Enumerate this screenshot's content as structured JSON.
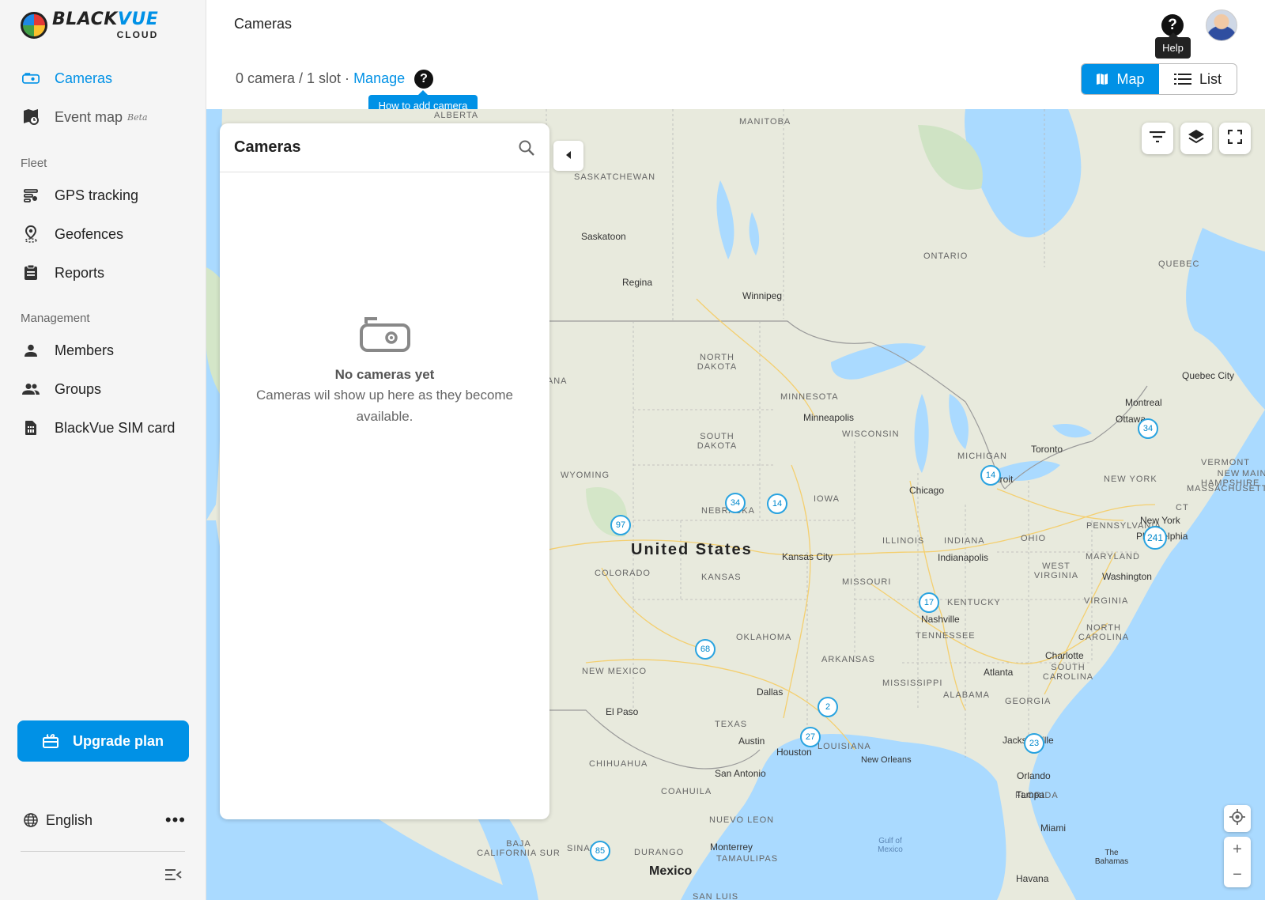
{
  "brand": {
    "name_black": "BLACK",
    "name_vue": "VUE",
    "sub": "CLOUD"
  },
  "sidebar": {
    "nav": [
      {
        "label": "Cameras",
        "icon": "camera-icon",
        "active": true
      },
      {
        "label": "Event map",
        "badge": "Beta",
        "icon": "event-map-icon"
      }
    ],
    "fleet_label": "Fleet",
    "fleet": [
      {
        "label": "GPS tracking",
        "icon": "gps-tracking-icon"
      },
      {
        "label": "Geofences",
        "icon": "geofence-icon"
      },
      {
        "label": "Reports",
        "icon": "reports-icon"
      }
    ],
    "management_label": "Management",
    "management": [
      {
        "label": "Members",
        "icon": "member-icon"
      },
      {
        "label": "Groups",
        "icon": "groups-icon"
      },
      {
        "label": "BlackVue SIM card",
        "icon": "sim-card-icon"
      }
    ],
    "upgrade_label": "Upgrade plan",
    "language": "English"
  },
  "header": {
    "title": "Cameras",
    "help_tooltip": "Help",
    "slot_text": "0 camera / 1 slot · ",
    "manage_link": "Manage",
    "how_to_tooltip": "How to add camera",
    "view_map": "Map",
    "view_list": "List"
  },
  "panel": {
    "title": "Cameras",
    "empty_title": "No cameras yet",
    "empty_desc": "Cameras wil show up here as they become available."
  },
  "map": {
    "country_labels": [
      "United States",
      "Mexico"
    ],
    "region_labels": [
      "MANITOBA",
      "SASKATCHEWAN",
      "ONTARIO",
      "QUEBEC",
      "ALBERTA",
      "NORTH DAKOTA",
      "MINNESOTA",
      "SOUTH DAKOTA",
      "WISCONSIN",
      "MICHIGAN",
      "IOWA",
      "NEBRASKA",
      "WYOMING",
      "COLORADO",
      "KANSAS",
      "MISSOURI",
      "ILLINOIS",
      "INDIANA",
      "OHIO",
      "PENNSYLVANIA",
      "NEW YORK",
      "VERMONT",
      "NEW HAMPSHIRE",
      "MASSACHUSETTS",
      "MAINE",
      "CT",
      "MARYLAND",
      "WEST VIRGINIA",
      "VIRGINIA",
      "KENTUCKY",
      "TENNESSEE",
      "NORTH CAROLINA",
      "SOUTH CAROLINA",
      "OKLAHOMA",
      "ARKANSAS",
      "MISSISSIPPI",
      "ALABAMA",
      "GEORGIA",
      "TEXAS",
      "LOUISIANA",
      "NEW MEXICO",
      "FLORIDA",
      "CHIHUAHUA",
      "COAHUILA",
      "NUEVO LEON",
      "TAMAULIPAS",
      "DURANGO",
      "SINALOA",
      "BAJA CALIFORNIA SUR",
      "TANA",
      "SAN LUIS"
    ],
    "city_labels": [
      "Saskatoon",
      "Regina",
      "Winnipeg",
      "Minneapolis",
      "Chicago",
      "Toronto",
      "Detroit",
      "Ottawa",
      "Montreal",
      "Quebec City",
      "New York",
      "Philadelphia",
      "Washington",
      "Indianapolis",
      "Kansas City",
      "Nashville",
      "Charlotte",
      "Atlanta",
      "Dallas",
      "Austin",
      "Houston",
      "San Antonio",
      "New Orleans",
      "El Paso",
      "Jacksonville",
      "Orlando",
      "Tampa",
      "Miami",
      "Monterrey",
      "Havana",
      "The Bahamas",
      "Gulf of Mexico"
    ],
    "clusters": [
      "34",
      "14",
      "34",
      "14",
      "97",
      "241",
      "17",
      "68",
      "2",
      "27",
      "23",
      "85"
    ]
  }
}
